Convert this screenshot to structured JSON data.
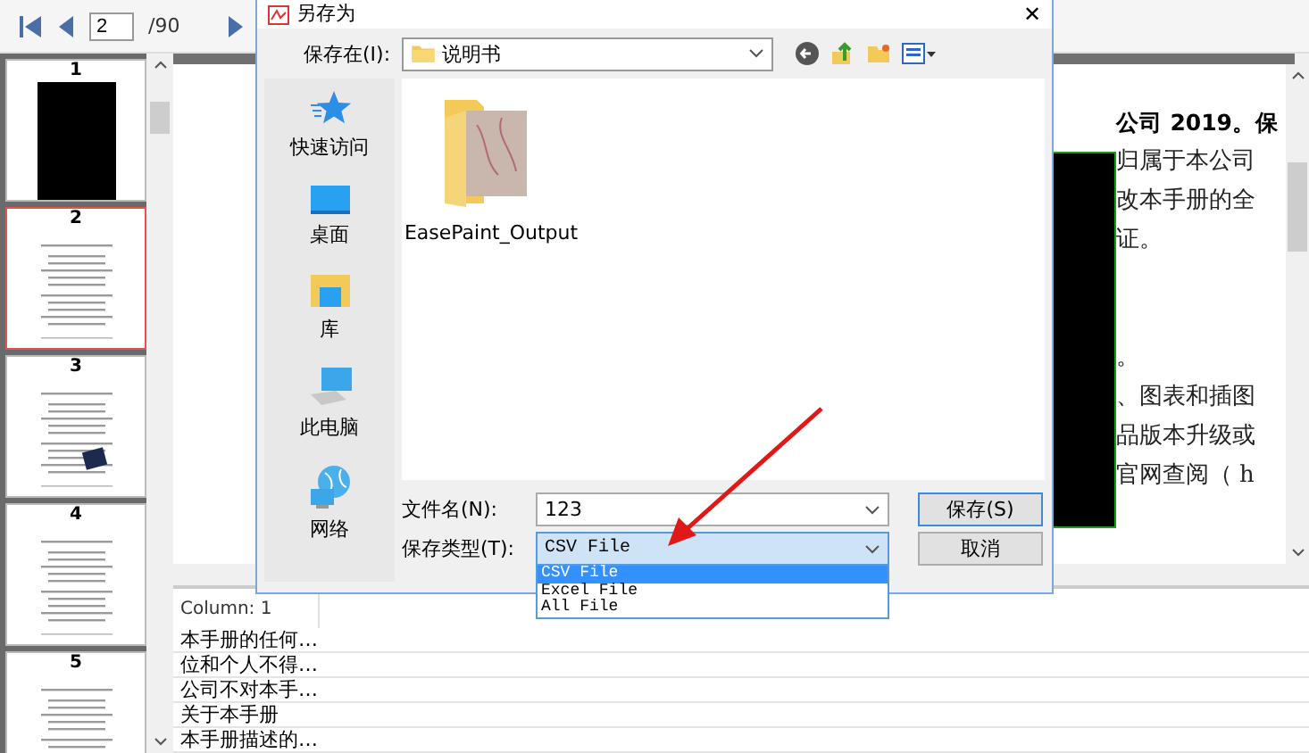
{
  "toolbar": {
    "page_input": "2",
    "page_count": "/90"
  },
  "thumbnails": [
    {
      "label": "1",
      "selected": false,
      "kind": "dark"
    },
    {
      "label": "2",
      "selected": true,
      "kind": "text"
    },
    {
      "label": "3",
      "selected": false,
      "kind": "image"
    },
    {
      "label": "4",
      "selected": false,
      "kind": "text"
    },
    {
      "label": "5",
      "selected": false,
      "kind": "text"
    }
  ],
  "document": {
    "heading": "公司 2019。保",
    "paragraphs": [
      [
        "归属于本公司",
        "改本手册的全",
        "证。"
      ],
      [
        "。",
        "、图表和插图",
        "品版本升级或",
        "官网查阅（ h"
      ]
    ]
  },
  "table": {
    "columns": [
      "Column: 1"
    ],
    "rows": [
      "本手册的任何…",
      "位和个人不得…",
      "公司不对本手…",
      "关于本手册",
      "本手册描述的…"
    ]
  },
  "dialog": {
    "title": "另存为",
    "close": "✕",
    "location_label": "保存在(I):",
    "location": "说明书",
    "places": [
      {
        "label": "快速访问",
        "kind": "star"
      },
      {
        "label": "桌面",
        "kind": "desktop"
      },
      {
        "label": "库",
        "kind": "library"
      },
      {
        "label": "此电脑",
        "kind": "computer"
      },
      {
        "label": "网络",
        "kind": "network"
      }
    ],
    "files": [
      {
        "name": "EasePaint_Output"
      }
    ],
    "filename_label": "文件名(N):",
    "filename": "123",
    "type_label": "保存类型(T):",
    "type": "CSV File",
    "type_options": [
      {
        "label": "CSV File",
        "selected": true
      },
      {
        "label": "Excel File",
        "selected": false
      },
      {
        "label": "All File",
        "selected": false
      }
    ],
    "buttons": [
      {
        "label": "保存(S)",
        "default": true
      },
      {
        "label": "取消",
        "default": false
      }
    ]
  }
}
